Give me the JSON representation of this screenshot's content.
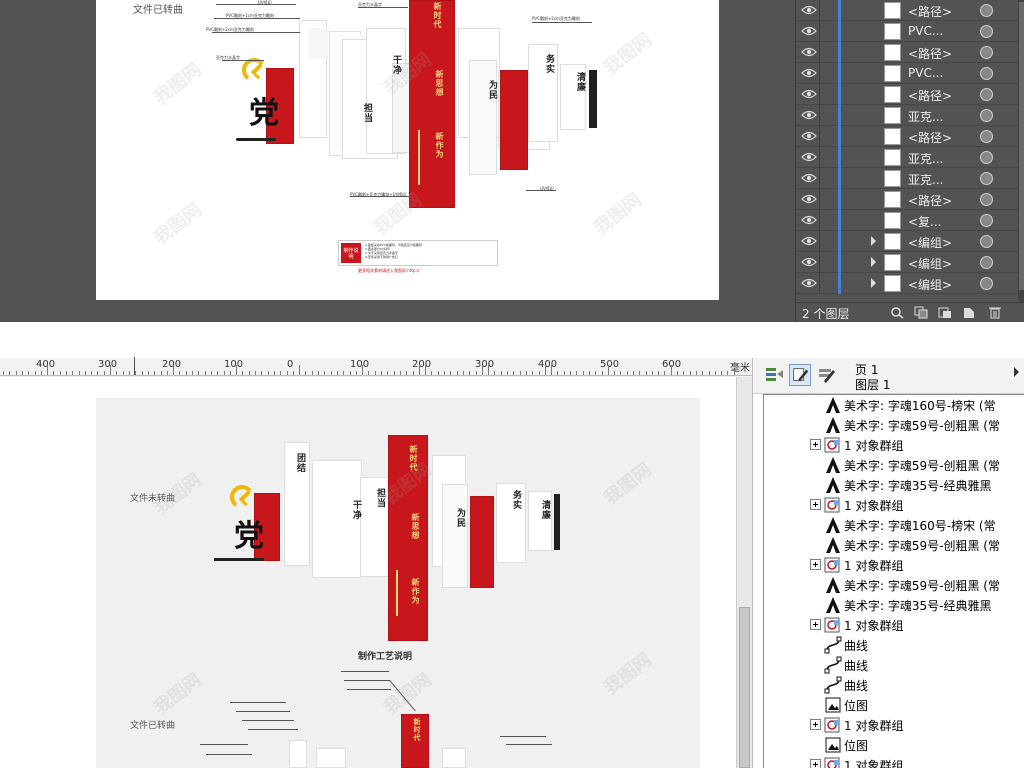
{
  "illustrator": {
    "artboard": {
      "side_label": "文件已转曲",
      "annotations": [
        "UV喷印",
        "PVC雕刻+1cm亚克力雕刻",
        "PVC雕刻+2cm亚克力雕刻",
        "亚克力水晶字",
        "亚克力水晶字",
        "PVC雕刻+2cm亚克力雕刻",
        "PVC雕刻+亚克力雕刻+UV喷印",
        "UV喷印"
      ],
      "titles": [
        "新时代",
        "新思想",
        "新作为",
        "为民",
        "务实",
        "清廉",
        "干净",
        "担当"
      ],
      "party_char": "党",
      "notes_box_title": "制作说明",
      "notes_box_lines": [
        "1.面板采用PVC板雕刻，背板亚克力板雕刻",
        "2.图案部分UV喷印",
        "3.文字采用亚克力水晶字",
        "4.安装采用不锈钢广告钉"
      ],
      "notes_box_footer": "更多相关素材请进入我图网 http://"
    },
    "layers_panel": {
      "rows": [
        {
          "name": "<路径>",
          "expandable": false
        },
        {
          "name": "PVC...",
          "expandable": false
        },
        {
          "name": "<路径>",
          "expandable": false
        },
        {
          "name": "PVC...",
          "expandable": false
        },
        {
          "name": "<路径>",
          "expandable": false
        },
        {
          "name": "亚克...",
          "expandable": false
        },
        {
          "name": "<路径>",
          "expandable": false
        },
        {
          "name": "亚克...",
          "expandable": false
        },
        {
          "name": "亚克...",
          "expandable": false
        },
        {
          "name": "<路径>",
          "expandable": false
        },
        {
          "name": "<复...",
          "expandable": false
        },
        {
          "name": "<编组>",
          "expandable": true
        },
        {
          "name": "<编组>",
          "expandable": true
        },
        {
          "name": "<编组>",
          "expandable": true
        }
      ],
      "layer_count": "2 个图层"
    }
  },
  "corel": {
    "ruler": {
      "labels": [
        "400",
        "300",
        "200",
        "100",
        "0",
        "100",
        "200",
        "300",
        "400",
        "500",
        "600"
      ],
      "unit": "毫米"
    },
    "page": {
      "side_label_1": "文件未转曲",
      "side_label_2": "文件已转曲",
      "section_title": "制作工艺说明",
      "party_char": "党",
      "titles": [
        "新时代",
        "新思想",
        "新作为",
        "为民",
        "务实",
        "清廉",
        "干净",
        "担当",
        "团结"
      ]
    },
    "object_manager": {
      "page_label": "页 1",
      "layer_label": "图层 1",
      "items": [
        {
          "type": "text",
          "label": "美术字: 字魂160号-榜宋 (常",
          "expandable": false
        },
        {
          "type": "text",
          "label": "美术字: 字魂59号-创粗黑 (常",
          "expandable": false
        },
        {
          "type": "group",
          "label": "1 对象群组",
          "expandable": true
        },
        {
          "type": "text",
          "label": "美术字: 字魂59号-创粗黑 (常",
          "expandable": false
        },
        {
          "type": "text",
          "label": "美术字: 字魂35号-经典雅黑",
          "expandable": false
        },
        {
          "type": "group",
          "label": "1 对象群组",
          "expandable": true
        },
        {
          "type": "text",
          "label": "美术字: 字魂160号-榜宋 (常",
          "expandable": false
        },
        {
          "type": "text",
          "label": "美术字: 字魂59号-创粗黑 (常",
          "expandable": false
        },
        {
          "type": "group",
          "label": "1 对象群组",
          "expandable": true
        },
        {
          "type": "text",
          "label": "美术字: 字魂59号-创粗黑 (常",
          "expandable": false
        },
        {
          "type": "text",
          "label": "美术字: 字魂35号-经典雅黑",
          "expandable": false
        },
        {
          "type": "group",
          "label": "1 对象群组",
          "expandable": true
        },
        {
          "type": "curve",
          "label": "曲线",
          "expandable": false
        },
        {
          "type": "curve",
          "label": "曲线",
          "expandable": false
        },
        {
          "type": "curve",
          "label": "曲线",
          "expandable": false
        },
        {
          "type": "bitmap",
          "label": "位图",
          "expandable": false
        },
        {
          "type": "group",
          "label": "1 对象群组",
          "expandable": true
        },
        {
          "type": "bitmap",
          "label": "位图",
          "expandable": false
        },
        {
          "type": "group",
          "label": "1 对象群组",
          "expandable": true
        }
      ]
    }
  },
  "watermark": "我图网",
  "colors": {
    "party_red": "#c8161d",
    "emblem_gold": "#f2b705",
    "selection_blue": "#4a7fd8",
    "ai_bg": "#535353"
  }
}
